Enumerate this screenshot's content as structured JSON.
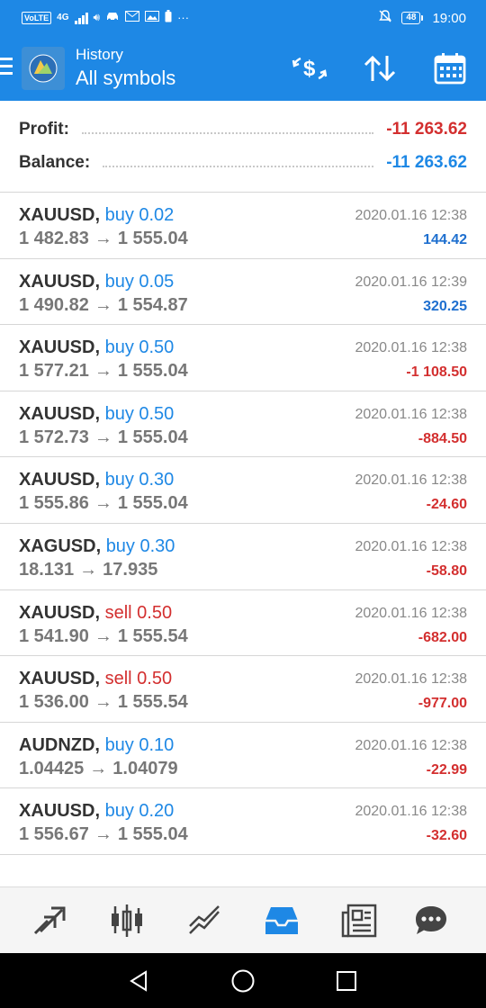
{
  "status_bar": {
    "volte": "VoLTE",
    "network": "4G",
    "battery": "48",
    "time": "19:00"
  },
  "header": {
    "title": "History",
    "subtitle": "All symbols",
    "icons": [
      "menu-icon",
      "dollar-exchange-icon",
      "sort-icon",
      "calendar-icon"
    ],
    "accent": "#1e88e5"
  },
  "summary": {
    "profit_label": "Profit:",
    "profit_value": "-11 263.62",
    "balance_label": "Balance:",
    "balance_value": "-11 263.62"
  },
  "trades": [
    {
      "symbol": "XAUUSD,",
      "side": "buy 0.02",
      "type": "buy",
      "open": "1 482.83",
      "close": "1 555.04",
      "time": "2020.01.16 12:38",
      "profit": "144.42",
      "positive": true
    },
    {
      "symbol": "XAUUSD,",
      "side": "buy 0.05",
      "type": "buy",
      "open": "1 490.82",
      "close": "1 554.87",
      "time": "2020.01.16 12:39",
      "profit": "320.25",
      "positive": true
    },
    {
      "symbol": "XAUUSD,",
      "side": "buy 0.50",
      "type": "buy",
      "open": "1 577.21",
      "close": "1 555.04",
      "time": "2020.01.16 12:38",
      "profit": "-1 108.50",
      "positive": false
    },
    {
      "symbol": "XAUUSD,",
      "side": "buy 0.50",
      "type": "buy",
      "open": "1 572.73",
      "close": "1 555.04",
      "time": "2020.01.16 12:38",
      "profit": "-884.50",
      "positive": false
    },
    {
      "symbol": "XAUUSD,",
      "side": "buy 0.30",
      "type": "buy",
      "open": "1 555.86",
      "close": "1 555.04",
      "time": "2020.01.16 12:38",
      "profit": "-24.60",
      "positive": false
    },
    {
      "symbol": "XAGUSD,",
      "side": "buy 0.30",
      "type": "buy",
      "open": "18.131",
      "close": "17.935",
      "time": "2020.01.16 12:38",
      "profit": "-58.80",
      "positive": false
    },
    {
      "symbol": "XAUUSD,",
      "side": "sell 0.50",
      "type": "sell",
      "open": "1 541.90",
      "close": "1 555.54",
      "time": "2020.01.16 12:38",
      "profit": "-682.00",
      "positive": false
    },
    {
      "symbol": "XAUUSD,",
      "side": "sell 0.50",
      "type": "sell",
      "open": "1 536.00",
      "close": "1 555.54",
      "time": "2020.01.16 12:38",
      "profit": "-977.00",
      "positive": false
    },
    {
      "symbol": "AUDNZD,",
      "side": "buy 0.10",
      "type": "buy",
      "open": "1.04425",
      "close": "1.04079",
      "time": "2020.01.16 12:38",
      "profit": "-22.99",
      "positive": false
    },
    {
      "symbol": "XAUUSD,",
      "side": "buy 0.20",
      "type": "buy",
      "open": "1 556.67",
      "close": "1 555.04",
      "time": "2020.01.16 12:38",
      "profit": "-32.60",
      "positive": false
    }
  ],
  "bottom_nav": {
    "items": [
      "quotes-icon",
      "chart-icon",
      "trade-icon",
      "history-icon",
      "news-icon",
      "chat-icon"
    ],
    "active": "history-icon",
    "active_color": "#1e88e5",
    "inactive_color": "#444444"
  },
  "system_nav": [
    "back-icon",
    "home-icon",
    "recents-icon"
  ]
}
